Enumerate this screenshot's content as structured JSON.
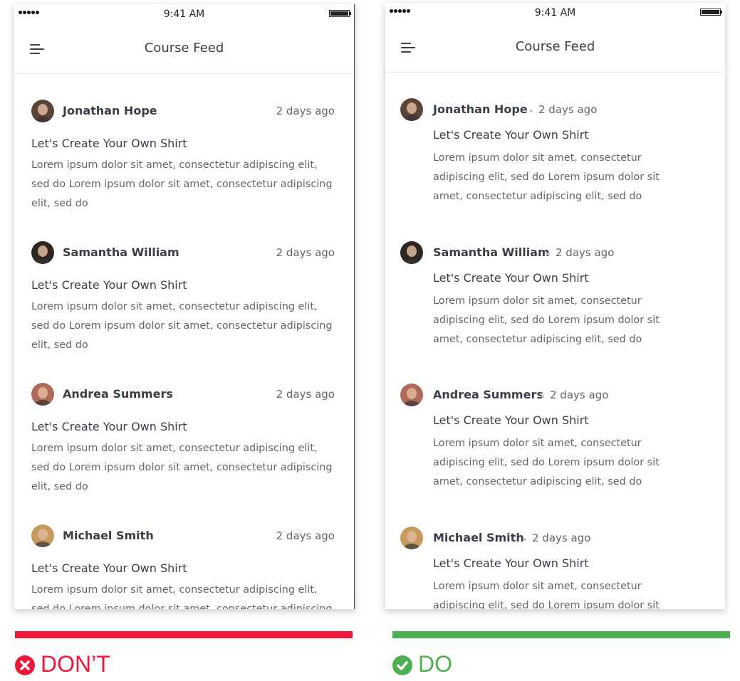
{
  "colors": {
    "dont": "#f0173a",
    "do": "#4caf50",
    "text": "#3a3f47",
    "muted": "#62666d"
  },
  "status_bar": {
    "time": "9:41 AM"
  },
  "header": {
    "title": "Course Feed",
    "menu_icon": "hamburger-menu-icon"
  },
  "feed": [
    {
      "author": "Jonathan Hope",
      "time": "2 days ago",
      "title": "Let's Create Your Own Shirt",
      "body": "Lorem ipsum dolor sit amet, consectetur adipiscing elit, sed do Lorem ipsum dolor sit amet, consectetur adipiscing elit, sed do",
      "avatar_color": "#5a4436"
    },
    {
      "author": "Samantha William",
      "time": "2 days ago",
      "title": "Let's Create Your Own Shirt",
      "body": "Lorem ipsum dolor sit amet, consectetur adipiscing elit, sed do Lorem ipsum dolor sit amet, consectetur adipiscing elit, sed do",
      "avatar_color": "#2b2622"
    },
    {
      "author": "Andrea Summers",
      "time": "2 days ago",
      "title": "Let's Create Your Own Shirt",
      "body": "Lorem ipsum dolor sit amet, consectetur adipiscing elit, sed do Lorem ipsum dolor sit amet, consectetur adipiscing elit, sed do",
      "avatar_color": "#b06a5a"
    },
    {
      "author": "Michael Smith",
      "time": "2 days ago",
      "title": "Let's Create Your Own Shirt",
      "body": "Lorem ipsum dolor sit amet, consectetur adipiscing elit, sed do Lorem ipsum dolor sit amet, consectetur adipiscing elit, sed do",
      "avatar_color": "#c79a5e"
    }
  ],
  "labels": {
    "dont": "DON’T",
    "do": "DO"
  }
}
